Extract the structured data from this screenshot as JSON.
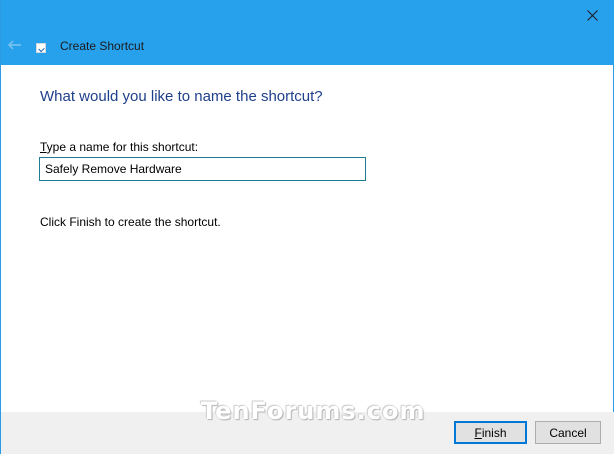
{
  "window": {
    "title": "Create Shortcut"
  },
  "icons": {
    "back": "back-arrow-icon",
    "close": "close-icon",
    "app": "shortcut-icon"
  },
  "colors": {
    "titlebar": "#28a1ed",
    "heading": "#1e3f8a",
    "input_border": "#1f7a94",
    "default_button_border": "#0078d7"
  },
  "main": {
    "heading": "What would you like to name the shortcut?",
    "field_label_mnemonic": "T",
    "field_label_rest": "ype a name for this shortcut:",
    "name_value": "Safely Remove Hardware",
    "hint": "Click Finish to create the shortcut."
  },
  "watermark": "TenForums.com",
  "buttons": {
    "finish_mnemonic": "F",
    "finish_rest": "inish",
    "cancel": "Cancel"
  }
}
